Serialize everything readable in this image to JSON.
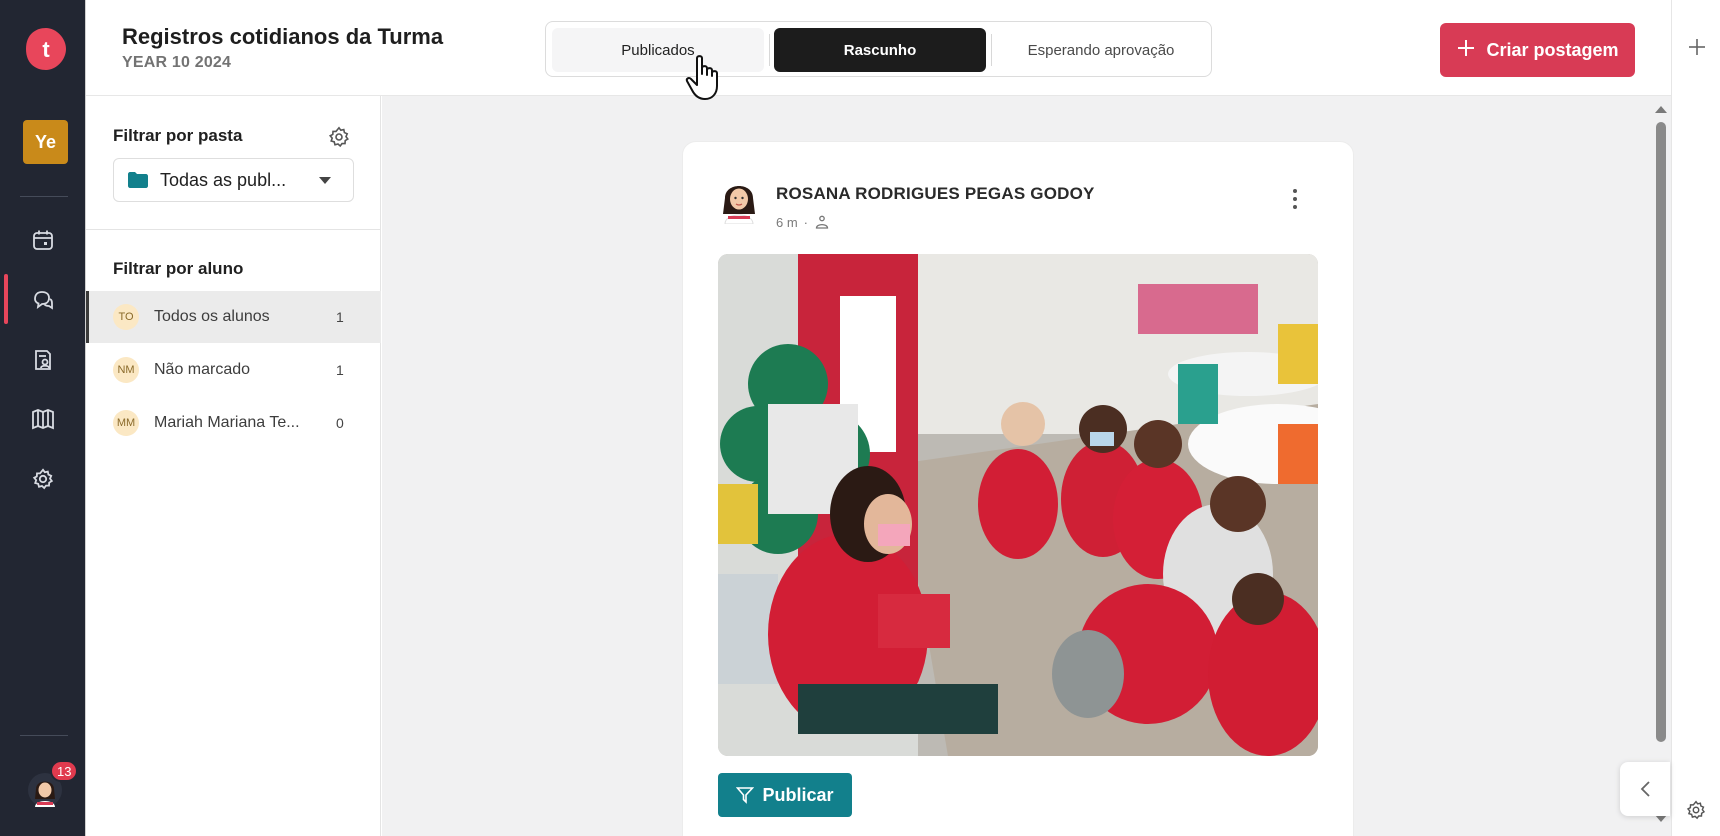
{
  "app": {
    "logo_letter": "t",
    "workspace_badge": "Ye",
    "notification_count": "13",
    "brand_color": "#e8465b"
  },
  "header": {
    "title": "Registros cotidianos da Turma",
    "subtitle": "YEAR 10 2024",
    "tabs": [
      {
        "label": "Publicados",
        "state": "hover"
      },
      {
        "label": "Rascunho",
        "state": "selected"
      },
      {
        "label": "Esperando aprovação",
        "state": "default"
      }
    ],
    "create_button": "Criar postagem"
  },
  "nav": {
    "icons": [
      "calendar-icon",
      "chat-icon",
      "student-report-icon",
      "library-icon",
      "settings-icon"
    ]
  },
  "filters": {
    "folder_heading": "Filtrar por pasta",
    "folder_selected": "Todas as publ...",
    "student_heading": "Filtrar por aluno",
    "students": [
      {
        "initials": "TO",
        "name": "Todos os alunos",
        "count": "1"
      },
      {
        "initials": "NM",
        "name": "Não marcado",
        "count": "1"
      },
      {
        "initials": "MM",
        "name": "Mariah Mariana Te...",
        "count": "0"
      }
    ]
  },
  "post": {
    "author": "ROSANA RODRIGUES PEGAS GODOY",
    "time": "6 m",
    "publish_button": "Publicar"
  }
}
